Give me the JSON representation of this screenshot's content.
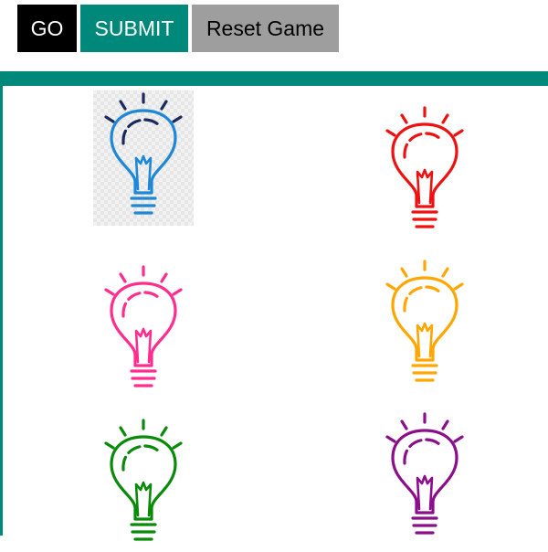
{
  "toolbar": {
    "go_label": "GO",
    "submit_label": "SUBMIT",
    "reset_label": "Reset Game"
  },
  "colors": {
    "frame": "#00897b",
    "go_bg": "#000000",
    "go_text": "#ffffff",
    "submit_bg": "#00897b",
    "submit_text": "#ffffff",
    "reset_bg": "#9e9e9e",
    "reset_text": "#000000"
  },
  "bulbs": [
    {
      "id": "blue",
      "color": "#1e88d6",
      "accent": "#1a2a5e",
      "selected": true
    },
    {
      "id": "red",
      "color": "#ee1111",
      "accent": "#ee1111",
      "selected": false
    },
    {
      "id": "pink",
      "color": "#ff2d8e",
      "accent": "#ff2d8e",
      "selected": false
    },
    {
      "id": "orange",
      "color": "#ffa600",
      "accent": "#ffa600",
      "selected": false
    },
    {
      "id": "green",
      "color": "#0a8a0a",
      "accent": "#0a8a0a",
      "selected": false
    },
    {
      "id": "purple",
      "color": "#8b0f8b",
      "accent": "#8b0f8b",
      "selected": false
    }
  ]
}
